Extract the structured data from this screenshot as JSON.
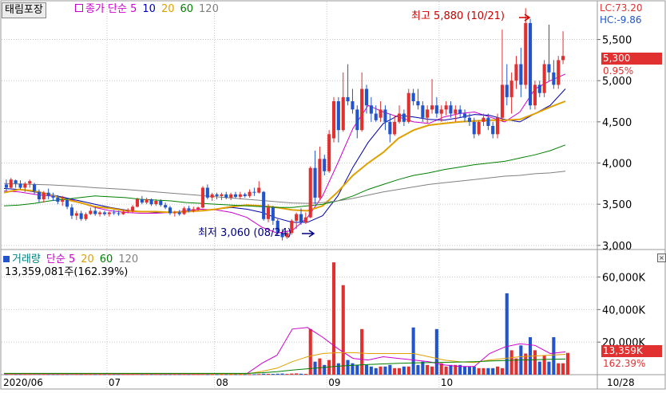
{
  "header": {
    "stock_name": "태림포장",
    "price_legend": [
      {
        "label": "종가 단순 5",
        "color": "#cc00cc"
      },
      {
        "label": "10",
        "color": "#0000aa"
      },
      {
        "label": "20",
        "color": "#e0a000"
      },
      {
        "label": "60",
        "color": "#008000"
      },
      {
        "label": "120",
        "color": "#808080"
      }
    ],
    "lc": "LC:73.20",
    "hc": "HC:-9.86"
  },
  "annotations": {
    "high": "최고 5,880 (10/21)",
    "low": "최저 3,060 (08/24)"
  },
  "price_tags": {
    "current": "5,300",
    "change_pct": "0.95%"
  },
  "volume_header": {
    "legend": [
      {
        "label": "거래량",
        "color": "#008080"
      },
      {
        "label": "단순 5",
        "color": "#cc00cc"
      },
      {
        "label": "20",
        "color": "#e0a000"
      },
      {
        "label": "60",
        "color": "#008000"
      },
      {
        "label": "120",
        "color": "#808080"
      }
    ],
    "summary": "13,359,081주(162.39%)"
  },
  "volume_tags": {
    "current": "13,359K",
    "pct": "162.39%"
  },
  "colors": {
    "up": "#e03030",
    "down": "#2255cc"
  },
  "chart_data": {
    "type": "candlestick",
    "date_labels": [
      "2020/06",
      "07",
      "08",
      "09",
      "10",
      "10/28"
    ],
    "price_axis": {
      "ticks": [
        "5,500",
        "5,000",
        "4,500",
        "4,000",
        "3,500",
        "3,000"
      ],
      "ylim": [
        2950,
        5960
      ]
    },
    "volume_axis": {
      "ticks": [
        "60,000K",
        "40,000K",
        "20,000K"
      ],
      "ylim": [
        0,
        72000
      ]
    },
    "candles": [
      [
        3740,
        3800,
        3660,
        3700
      ],
      [
        3700,
        3820,
        3680,
        3800
      ],
      [
        3790,
        3800,
        3700,
        3750
      ],
      [
        3750,
        3790,
        3680,
        3700
      ],
      [
        3700,
        3770,
        3650,
        3750
      ],
      [
        3750,
        3800,
        3700,
        3780
      ],
      [
        3740,
        3760,
        3620,
        3660
      ],
      [
        3650,
        3680,
        3520,
        3560
      ],
      [
        3560,
        3660,
        3520,
        3640
      ],
      [
        3640,
        3690,
        3560,
        3600
      ],
      [
        3600,
        3640,
        3540,
        3580
      ],
      [
        3580,
        3610,
        3500,
        3530
      ],
      [
        3530,
        3600,
        3480,
        3550
      ],
      [
        3550,
        3580,
        3440,
        3470
      ],
      [
        3460,
        3500,
        3320,
        3360
      ],
      [
        3360,
        3420,
        3310,
        3390
      ],
      [
        3390,
        3420,
        3300,
        3320
      ],
      [
        3320,
        3400,
        3300,
        3380
      ],
      [
        3380,
        3460,
        3370,
        3420
      ],
      [
        3420,
        3470,
        3360,
        3380
      ],
      [
        3380,
        3420,
        3350,
        3400
      ],
      [
        3400,
        3420,
        3360,
        3380
      ],
      [
        3380,
        3410,
        3350,
        3400
      ],
      [
        3400,
        3430,
        3370,
        3390
      ],
      [
        3390,
        3420,
        3360,
        3380
      ],
      [
        3380,
        3430,
        3370,
        3410
      ],
      [
        3410,
        3450,
        3390,
        3420
      ],
      [
        3420,
        3490,
        3400,
        3470
      ],
      [
        3470,
        3580,
        3460,
        3560
      ],
      [
        3560,
        3600,
        3500,
        3520
      ],
      [
        3520,
        3580,
        3500,
        3560
      ],
      [
        3560,
        3570,
        3480,
        3500
      ],
      [
        3500,
        3560,
        3480,
        3540
      ],
      [
        3540,
        3560,
        3470,
        3490
      ],
      [
        3490,
        3520,
        3440,
        3460
      ],
      [
        3460,
        3480,
        3370,
        3390
      ],
      [
        3390,
        3420,
        3350,
        3400
      ],
      [
        3400,
        3430,
        3360,
        3380
      ],
      [
        3380,
        3470,
        3370,
        3450
      ],
      [
        3450,
        3480,
        3400,
        3420
      ],
      [
        3420,
        3470,
        3400,
        3440
      ],
      [
        3440,
        3470,
        3420,
        3460
      ],
      [
        3460,
        3720,
        3450,
        3700
      ],
      [
        3700,
        3740,
        3560,
        3580
      ],
      [
        3580,
        3640,
        3540,
        3620
      ],
      [
        3620,
        3640,
        3560,
        3600
      ],
      [
        3600,
        3640,
        3550,
        3620
      ],
      [
        3620,
        3650,
        3560,
        3580
      ],
      [
        3580,
        3640,
        3550,
        3620
      ],
      [
        3620,
        3650,
        3570,
        3590
      ],
      [
        3590,
        3650,
        3560,
        3620
      ],
      [
        3620,
        3640,
        3580,
        3600
      ],
      [
        3600,
        3680,
        3580,
        3650
      ],
      [
        3650,
        3700,
        3600,
        3640
      ],
      [
        3640,
        3780,
        3630,
        3700
      ],
      [
        3650,
        3660,
        3300,
        3320
      ],
      [
        3320,
        3500,
        3280,
        3460
      ],
      [
        3460,
        3480,
        3250,
        3300
      ],
      [
        3300,
        3320,
        3120,
        3150
      ],
      [
        3150,
        3200,
        3060,
        3100
      ],
      [
        3100,
        3180,
        3080,
        3150
      ],
      [
        3150,
        3320,
        3130,
        3300
      ],
      [
        3300,
        3400,
        3200,
        3380
      ],
      [
        3380,
        3450,
        3250,
        3280
      ],
      [
        3280,
        3400,
        3260,
        3340
      ],
      [
        3340,
        3960,
        3330,
        3940
      ],
      [
        3940,
        4150,
        3500,
        3580
      ],
      [
        3580,
        4200,
        3560,
        4050
      ],
      [
        4050,
        4100,
        3850,
        3900
      ],
      [
        3900,
        4400,
        3880,
        4350
      ],
      [
        4300,
        4800,
        4250,
        4750
      ],
      [
        4750,
        4800,
        4250,
        4400
      ],
      [
        4400,
        5100,
        4380,
        4800
      ],
      [
        4800,
        5200,
        4700,
        4750
      ],
      [
        4750,
        4900,
        4600,
        4650
      ],
      [
        4650,
        4700,
        4300,
        4400
      ],
      [
        4400,
        5100,
        4380,
        4900
      ],
      [
        4900,
        4950,
        4600,
        4700
      ],
      [
        4700,
        4800,
        4500,
        4600
      ],
      [
        4600,
        4700,
        4500,
        4520
      ],
      [
        4550,
        4750,
        4500,
        4650
      ],
      [
        4650,
        4700,
        4400,
        4500
      ],
      [
        4500,
        4600,
        4250,
        4350
      ],
      [
        4350,
        4580,
        4330,
        4500
      ],
      [
        4500,
        4700,
        4480,
        4600
      ],
      [
        4600,
        4650,
        4450,
        4500
      ],
      [
        4500,
        4900,
        4480,
        4850
      ],
      [
        4850,
        4900,
        4700,
        4750
      ],
      [
        4750,
        4900,
        4650,
        4700
      ],
      [
        4700,
        4750,
        4500,
        4550
      ],
      [
        4550,
        4700,
        4480,
        4650
      ],
      [
        4650,
        5020,
        4600,
        4700
      ],
      [
        4700,
        4800,
        4550,
        4600
      ],
      [
        4600,
        4700,
        4500,
        4650
      ],
      [
        4650,
        4750,
        4580,
        4700
      ],
      [
        4700,
        4750,
        4550,
        4600
      ],
      [
        4600,
        4700,
        4500,
        4650
      ],
      [
        4650,
        4700,
        4550,
        4600
      ],
      [
        4600,
        4650,
        4500,
        4550
      ],
      [
        4550,
        4600,
        4450,
        4500
      ],
      [
        4500,
        4550,
        4300,
        4350
      ],
      [
        4350,
        4520,
        4330,
        4500
      ],
      [
        4500,
        4600,
        4450,
        4550
      ],
      [
        4550,
        4600,
        4400,
        4450
      ],
      [
        4450,
        4500,
        4300,
        4350
      ],
      [
        4350,
        4600,
        4300,
        4550
      ],
      [
        4550,
        5620,
        4500,
        4950
      ],
      [
        4950,
        5200,
        4700,
        4800
      ],
      [
        4800,
        5100,
        4600,
        5000
      ],
      [
        5000,
        5300,
        4900,
        5200
      ],
      [
        5200,
        5400,
        4800,
        4950
      ],
      [
        4950,
        5880,
        4900,
        5700
      ],
      [
        5700,
        5750,
        4650,
        4700
      ],
      [
        4700,
        5000,
        4650,
        4950
      ],
      [
        4950,
        5000,
        4800,
        4850
      ],
      [
        4850,
        5250,
        4800,
        5200
      ],
      [
        5200,
        5680,
        5000,
        5100
      ],
      [
        5100,
        5250,
        4900,
        4950
      ],
      [
        4950,
        5300,
        4900,
        5250
      ],
      [
        5250,
        5600,
        5200,
        5300
      ]
    ],
    "volume": [
      300,
      400,
      300,
      300,
      300,
      300,
      400,
      400,
      300,
      300,
      300,
      300,
      300,
      300,
      400,
      300,
      300,
      300,
      300,
      300,
      300,
      300,
      300,
      300,
      300,
      300,
      300,
      300,
      400,
      300,
      300,
      300,
      300,
      300,
      300,
      300,
      300,
      300,
      300,
      300,
      300,
      300,
      400,
      300,
      300,
      300,
      300,
      300,
      300,
      300,
      300,
      300,
      300,
      300,
      400,
      600,
      500,
      500,
      600,
      700,
      500,
      700,
      800,
      600,
      500,
      28000,
      8000,
      10000,
      6000,
      9000,
      69000,
      7000,
      55000,
      9000,
      7000,
      6000,
      28000,
      6000,
      5000,
      4000,
      5000,
      5000,
      6000,
      4000,
      4000,
      5000,
      5000,
      29000,
      6000,
      8000,
      6000,
      5000,
      28000,
      7000,
      5000,
      6000,
      6000,
      6000,
      5000,
      5000,
      5000,
      4000,
      4000,
      4000,
      4000,
      5000,
      4000,
      50000,
      15000,
      10000,
      18000,
      13000,
      23000,
      15000,
      8000,
      12000,
      8000,
      23000,
      7000,
      7000,
      13359
    ],
    "ma_price": {
      "ma5": [
        3660,
        3650,
        3620,
        3600,
        3580,
        3520,
        3460,
        3420,
        3400,
        3390,
        3390,
        3400,
        3420,
        3440,
        3430,
        3400,
        3340,
        3220,
        3150,
        3180,
        3340,
        3600,
        4000,
        4420,
        4700,
        4620,
        4560,
        4500,
        4480,
        4560,
        4600,
        4620,
        4560,
        4500,
        4620,
        4900,
        5000,
        5080
      ],
      "ma10": [
        3690,
        3680,
        3650,
        3620,
        3580,
        3540,
        3500,
        3460,
        3430,
        3410,
        3400,
        3400,
        3410,
        3420,
        3440,
        3460,
        3440,
        3400,
        3330,
        3280,
        3280,
        3360,
        3600,
        3950,
        4250,
        4480,
        4580,
        4560,
        4530,
        4520,
        4550,
        4590,
        4580,
        4530,
        4500,
        4600,
        4700,
        4900
      ],
      "ma20": [
        3640,
        3680,
        3660,
        3620,
        3560,
        3520,
        3470,
        3450,
        3420,
        3410,
        3410,
        3400,
        3410,
        3420,
        3440,
        3470,
        3490,
        3480,
        3460,
        3430,
        3420,
        3480,
        3650,
        3850,
        4000,
        4130,
        4300,
        4400,
        4460,
        4480,
        4500,
        4510,
        4520,
        4520,
        4530,
        4600,
        4680,
        4750
      ],
      "ma60": [
        3480,
        3490,
        3510,
        3540,
        3560,
        3580,
        3600,
        3590,
        3580,
        3560,
        3550,
        3540,
        3520,
        3510,
        3500,
        3490,
        3480,
        3470,
        3460,
        3460,
        3480,
        3500,
        3540,
        3600,
        3680,
        3740,
        3800,
        3850,
        3880,
        3920,
        3950,
        3980,
        4000,
        4020,
        4060,
        4100,
        4150,
        4220
      ],
      "ma120": [
        3750,
        3745,
        3740,
        3735,
        3725,
        3715,
        3700,
        3690,
        3680,
        3665,
        3650,
        3635,
        3620,
        3605,
        3590,
        3575,
        3560,
        3545,
        3530,
        3515,
        3510,
        3520,
        3540,
        3570,
        3610,
        3650,
        3680,
        3710,
        3740,
        3760,
        3780,
        3800,
        3820,
        3840,
        3850,
        3870,
        3880,
        3900
      ]
    },
    "ma_volume": {
      "ma5": [
        300,
        300,
        300,
        300,
        300,
        300,
        300,
        300,
        300,
        300,
        300,
        300,
        300,
        300,
        500,
        600,
        600,
        7000,
        12000,
        28000,
        29000,
        23000,
        16000,
        10000,
        9000,
        11000,
        10000,
        9000,
        8000,
        6000,
        5000,
        5000,
        13000,
        17000,
        19000,
        18000,
        13000,
        14000
      ],
      "ma20": [
        500,
        500,
        500,
        500,
        500,
        500,
        500,
        500,
        500,
        500,
        500,
        500,
        500,
        500,
        500,
        500,
        500,
        2000,
        4000,
        8000,
        11000,
        13000,
        13500,
        13500,
        13000,
        13000,
        13000,
        13000,
        11000,
        9000,
        8000,
        7500,
        9000,
        10000,
        11000,
        11500,
        12000,
        12500
      ],
      "ma60": [
        800,
        800,
        800,
        800,
        800,
        800,
        800,
        800,
        800,
        800,
        800,
        800,
        800,
        800,
        800,
        800,
        800,
        1200,
        1800,
        2800,
        3600,
        4400,
        5200,
        5800,
        6200,
        6600,
        7000,
        7200,
        7400,
        7600,
        7800,
        8000,
        8400,
        8700,
        9000,
        9200,
        9400,
        9600
      ]
    }
  }
}
